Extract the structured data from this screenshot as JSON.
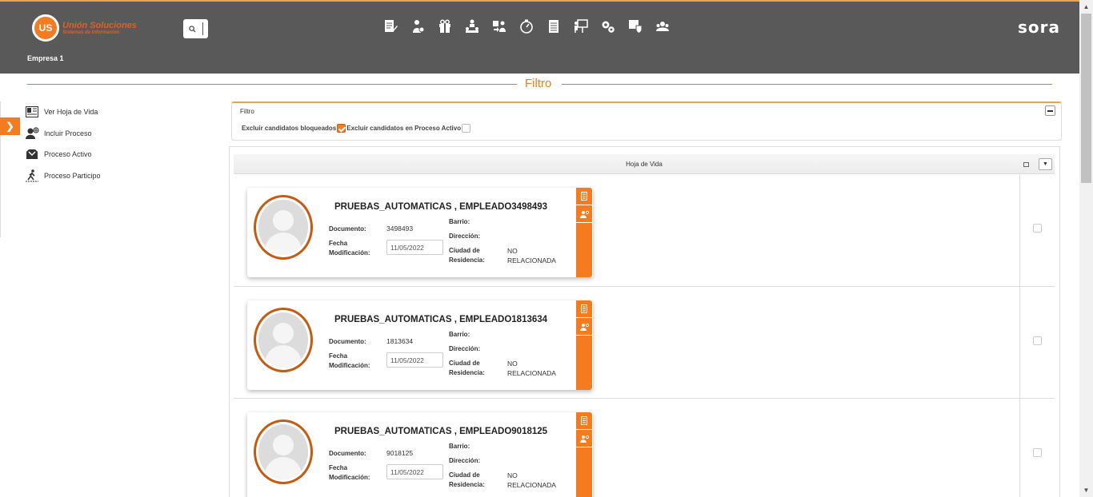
{
  "header": {
    "logo_mark": "US",
    "logo_title": "Unión Soluciones",
    "logo_subtitle": "Sistemas de Información",
    "company": "Empresa 1",
    "brand": "sora",
    "accent_color": "#f47b20",
    "top_icons": [
      "resume-edit-icon",
      "person-process-icon",
      "gift-icon",
      "org-chart-icon",
      "people-swap-icon",
      "timer-icon",
      "document-list-icon",
      "presentation-icon",
      "gears-icon",
      "shield-settings-icon",
      "group-icon"
    ]
  },
  "page_title": "Filtro",
  "sidebar": {
    "items": [
      {
        "label": "Ver Hoja de Vida",
        "icon": "resume-icon"
      },
      {
        "label": "Incluir Proceso",
        "icon": "user-add-icon"
      },
      {
        "label": "Proceso Activo",
        "icon": "inbox-icon"
      },
      {
        "label": "Proceso Participo",
        "icon": "walking-person-icon"
      }
    ]
  },
  "filter": {
    "title": "Filtro",
    "excluir_bloqueados_label": "Excluir candidatos bloqueados",
    "excluir_bloqueados_checked": true,
    "excluir_proceso_label": "Excluir candidatos en Proceso Activo",
    "excluir_proceso_checked": false
  },
  "grid": {
    "title": "Hoja de Vida",
    "labels": {
      "documento": "Documento:",
      "fecha_1": "Fecha",
      "fecha_2": "Modificación:",
      "barrio": "Barrio:",
      "direccion": "Dirección:",
      "ciudad_1": "Ciudad de",
      "ciudad_2": "Residencia:"
    },
    "rows": [
      {
        "name": "PRUEBAS_AUTOMATICAS , EMPLEADO3498493",
        "documento": "3498493",
        "fecha": "11/05/2022",
        "barrio": "",
        "direccion": "",
        "ciudad_1": "NO",
        "ciudad_2": "RELACIONADA"
      },
      {
        "name": "PRUEBAS_AUTOMATICAS , EMPLEADO1813634",
        "documento": "1813634",
        "fecha": "11/05/2022",
        "barrio": "",
        "direccion": "",
        "ciudad_1": "NO",
        "ciudad_2": "RELACIONADA"
      },
      {
        "name": "PRUEBAS_AUTOMATICAS , EMPLEADO9018125",
        "documento": "9018125",
        "fecha": "11/05/2022",
        "barrio": "",
        "direccion": "",
        "ciudad_1": "NO",
        "ciudad_2": "RELACIONADA"
      }
    ]
  }
}
